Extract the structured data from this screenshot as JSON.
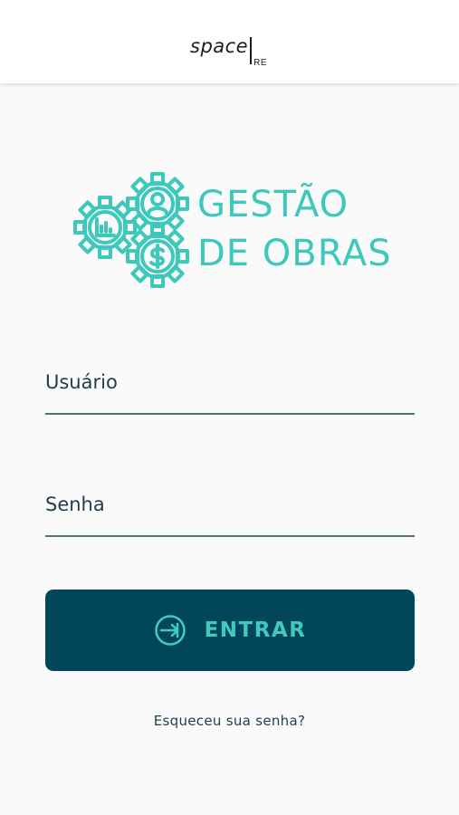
{
  "header": {
    "brand_main": "space",
    "brand_sub": "RE"
  },
  "logo": {
    "line1": "GESTÃO",
    "line2": "DE OBRAS",
    "icons": [
      "chart-gear-icon",
      "user-gear-icon",
      "dollar-gear-icon"
    ],
    "color": "#3cc8bb"
  },
  "form": {
    "username_placeholder": "Usuário",
    "password_placeholder": "Senha",
    "submit_label": "ENTRAR",
    "submit_icon": "arrow-right-circle-icon",
    "forgot_link": "Esqueceu sua senha?"
  },
  "colors": {
    "primary": "#01465a",
    "accent": "#42c9bd",
    "text": "#1e3e4c",
    "underline": "#4a7775"
  }
}
